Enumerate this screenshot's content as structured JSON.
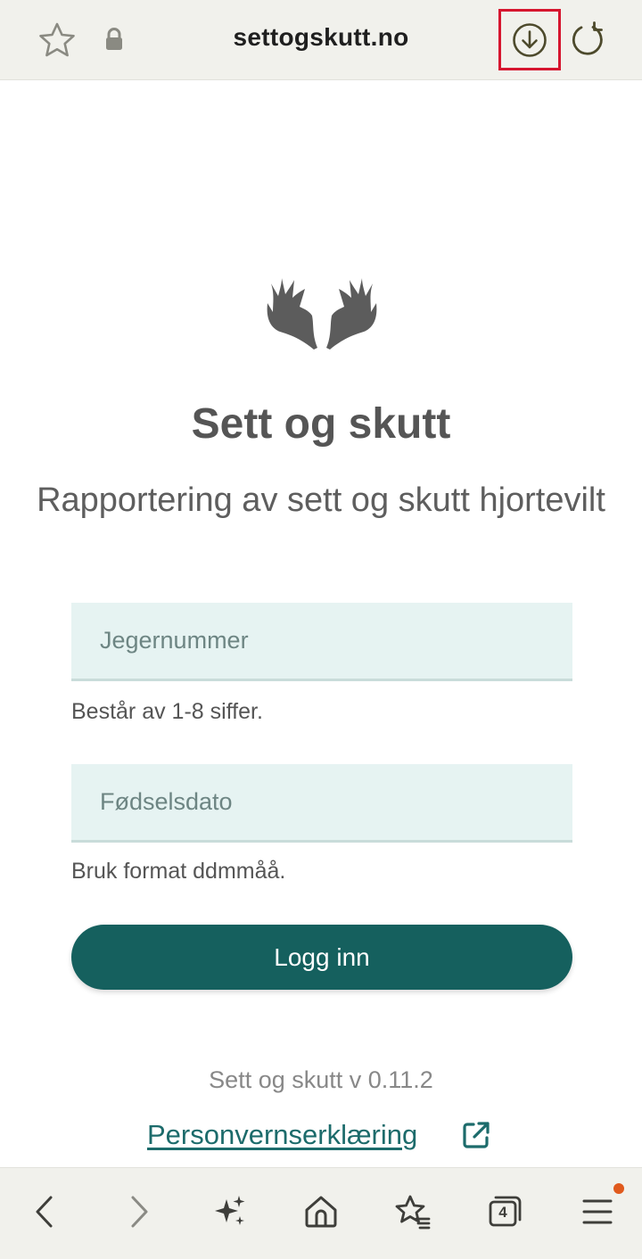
{
  "browser": {
    "url": "settogskutt.no",
    "tab_count": "4"
  },
  "page": {
    "title": "Sett og skutt",
    "subtitle": "Rapportering av sett og skutt hjortevilt",
    "hunter_number": {
      "placeholder": "Jegernummer",
      "value": "",
      "hint": "Består av 1-8 siffer."
    },
    "birth_date": {
      "placeholder": "Fødselsdato",
      "value": "",
      "hint": "Bruk format ddmmåå."
    },
    "login_label": "Logg inn",
    "version": "Sett og skutt v 0.11.2",
    "privacy_label": "Personvernserklæring"
  },
  "colors": {
    "accent": "#15605e",
    "link": "#1c6b6b",
    "field_bg": "#e6f3f2",
    "highlight": "#d6162f",
    "notification": "#e05a1d"
  },
  "icons": [
    "star-icon",
    "lock-icon",
    "download-icon",
    "reload-icon",
    "antlers-logo",
    "external-link-icon",
    "back-icon",
    "forward-icon",
    "sparkle-icon",
    "home-icon",
    "bookmarks-icon",
    "tabs-icon",
    "menu-icon"
  ]
}
